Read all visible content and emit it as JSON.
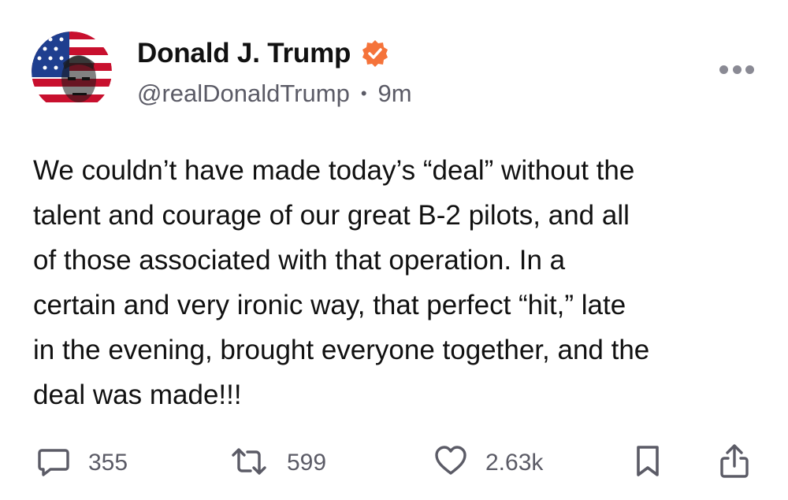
{
  "author": {
    "display_name": "Donald J. Trump",
    "handle": "@realDonaldTrump",
    "separator": "•",
    "time_ago": "9m",
    "verified_color": "#f5733a"
  },
  "post": {
    "text": "We couldn’t have made today’s “deal” without the\ntalent and courage of our great B-2 pilots, and all\nof those associated with that operation. In a\ncertain and very ironic way, that perfect “hit,” late\nin the evening, brought everyone together, and the\ndeal was made!!!"
  },
  "actions": {
    "replies": "355",
    "retruths": "599",
    "likes": "2.63k",
    "icon_color": "#5b5b66"
  },
  "icons": [
    "avatar",
    "verified-badge-icon",
    "more-options-icon",
    "reply-icon",
    "retruth-icon",
    "like-icon",
    "bookmark-icon",
    "share-icon"
  ]
}
